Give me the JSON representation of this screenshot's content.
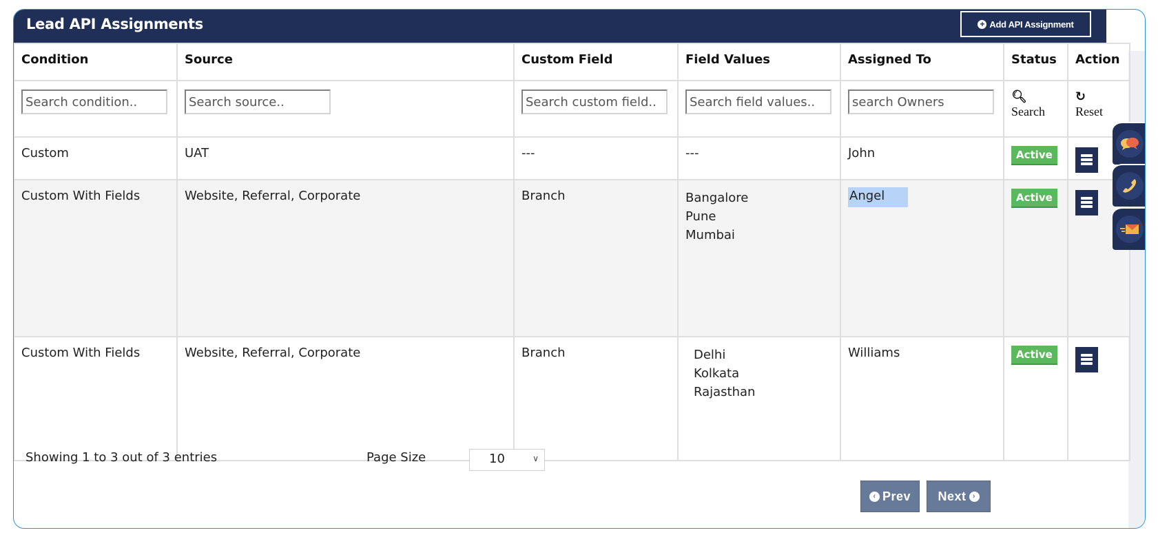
{
  "header": {
    "title": "Lead API Assignments",
    "add_button_label": "Add API Assignment",
    "add_button_icon": "plus-circle-icon"
  },
  "columns": [
    "Condition",
    "Source",
    "Custom Field",
    "Field Values",
    "Assigned To",
    "Status",
    "Action"
  ],
  "filters": {
    "condition_placeholder": "Search condition..",
    "source_placeholder": "Search source..",
    "custom_field_placeholder": "Search custom field..",
    "field_values_placeholder": "Search field values..",
    "owners_placeholder": "search Owners",
    "search_label": "Search",
    "reset_label": "Reset"
  },
  "rows": [
    {
      "condition": "Custom",
      "source": "UAT",
      "custom_field": "---",
      "field_values": [
        "---"
      ],
      "assigned_to": "John",
      "status": "Active"
    },
    {
      "condition": "Custom With Fields",
      "source": "Website, Referral, Corporate",
      "custom_field": "Branch",
      "field_values": [
        "Bangalore",
        "Pune",
        "Mumbai"
      ],
      "assigned_to": "Angel",
      "status": "Active"
    },
    {
      "condition": "Custom With Fields",
      "source": "Website, Referral, Corporate",
      "custom_field": "Branch",
      "field_values": [
        "Delhi",
        "Kolkata",
        "Rajasthan"
      ],
      "assigned_to": "Williams",
      "status": "Active"
    }
  ],
  "footer": {
    "summary": "Showing 1 to 3 out of 3 entries",
    "page_size_label": "Page Size",
    "page_size_value": "10",
    "prev_label": "Prev",
    "next_label": "Next"
  },
  "widgets": [
    {
      "name": "chat",
      "icon": "chat-bubbles-icon"
    },
    {
      "name": "phone",
      "icon": "phone-icon"
    },
    {
      "name": "email",
      "icon": "envelope-icon"
    }
  ],
  "colors": {
    "header_bg": "#1f2f57",
    "frame_border": "#2a93d5",
    "active_badge": "#5cb85c",
    "pager_button": "#687a9a",
    "selection_highlight": "#b7d3f7"
  }
}
